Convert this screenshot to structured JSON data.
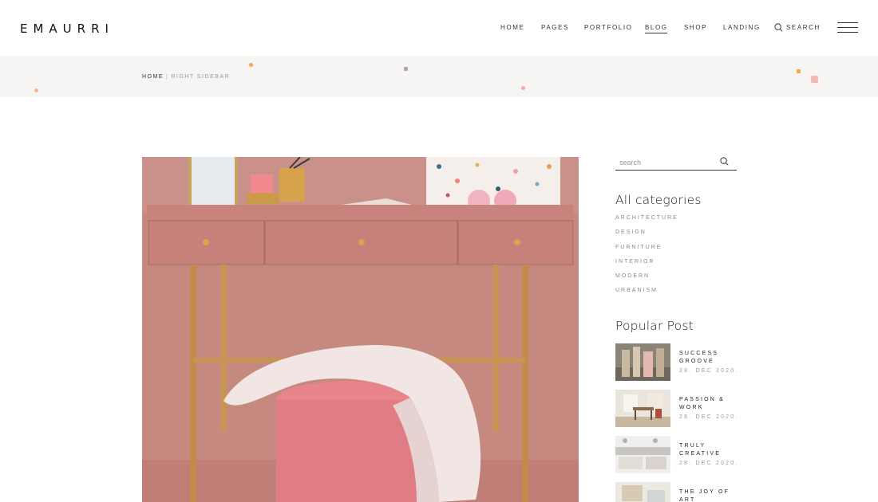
{
  "header": {
    "logo": "EMAURRI",
    "nav": [
      {
        "label": "HOME",
        "active": false
      },
      {
        "label": "PAGES",
        "active": false
      },
      {
        "label": "PORTFOLIO",
        "active": false
      },
      {
        "label": "BLOG",
        "active": true
      },
      {
        "label": "SHOP",
        "active": false
      },
      {
        "label": "LANDING",
        "active": false
      }
    ],
    "search_label": "SEARCH",
    "menu_icon": "hamburger-icon"
  },
  "breadcrumb": {
    "home": "HOME",
    "separator": "|",
    "current": "RIGHT SIDEBAR"
  },
  "sidebar": {
    "search_placeholder": "search",
    "categories_title": "All categories",
    "categories": [
      "ARCHITECTURE",
      "DESIGN",
      "FURNITURE",
      "INTERIOR",
      "MODERN",
      "URBANISM"
    ],
    "popular_title": "Popular Post",
    "posts": [
      {
        "title": "SUCCESS GROOVE",
        "date": "28. DEC 2020."
      },
      {
        "title": "PASSION & WORK",
        "date": "28. DEC 2020."
      },
      {
        "title": "TRULY CREATIVE",
        "date": "28. DEC 2020."
      },
      {
        "title": "THE JOY OF ART",
        "date": ""
      }
    ]
  },
  "colors": {
    "accent": "#f2a65a",
    "band": "#f7f5f3",
    "hero_wall": "#c98a80"
  }
}
